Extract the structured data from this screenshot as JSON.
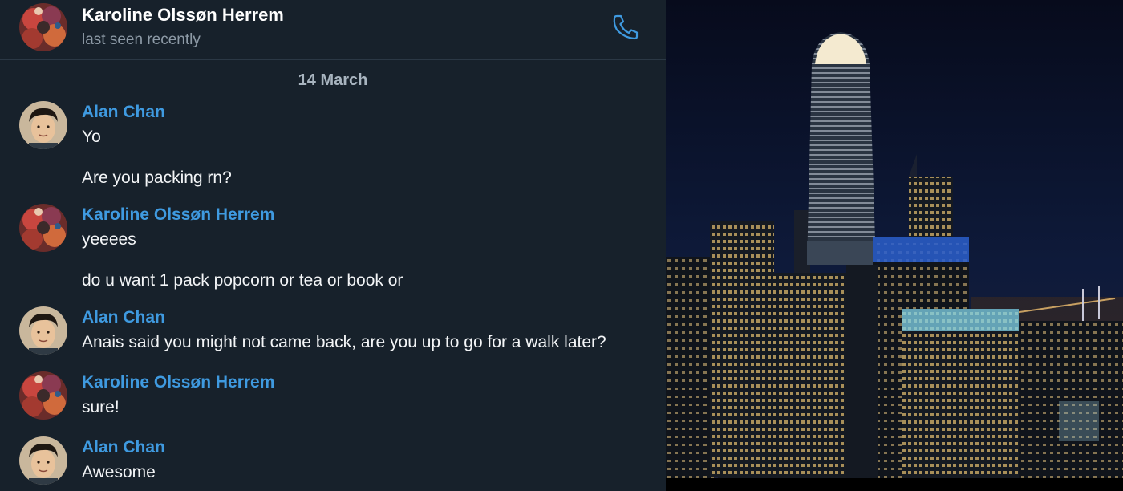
{
  "header": {
    "contact_name": "Karoline Olssøn Herrem",
    "status": "last seen recently",
    "call_icon": "phone-icon"
  },
  "date_separator": "14 March",
  "messages": [
    {
      "sender": "Alan Chan",
      "texts": [
        "Yo",
        "Are you packing rn?"
      ]
    },
    {
      "sender": "Karoline Olssøn Herrem",
      "texts": [
        "yeeees",
        "do u want 1 pack popcorn or tea or book or"
      ]
    },
    {
      "sender": "Alan Chan",
      "texts": [
        "Anais said you might not came back, are you up to go for a walk later?"
      ]
    },
    {
      "sender": "Karoline Olssøn Herrem",
      "texts": [
        "sure!"
      ]
    },
    {
      "sender": "Alan Chan",
      "texts": [
        "Awesome"
      ]
    }
  ],
  "colors": {
    "background": "#17212b",
    "sender_name": "#3f9ae0",
    "message_text": "#f3f5f7",
    "status_text": "#8d9aa6",
    "accent_icon": "#3f9ae0"
  }
}
